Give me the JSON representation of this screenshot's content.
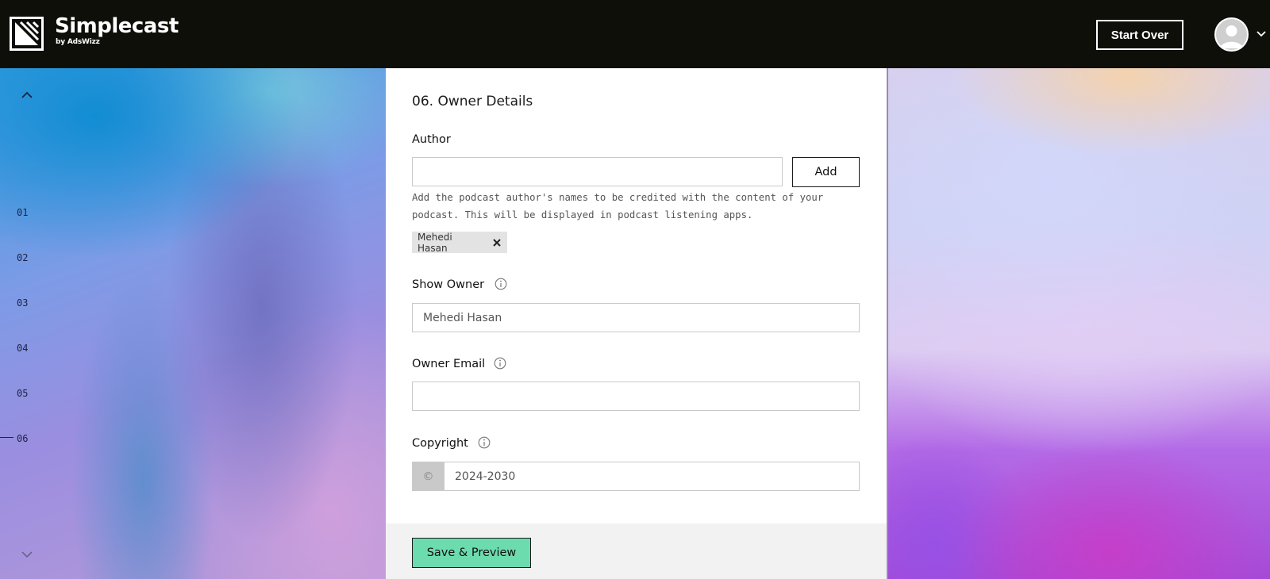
{
  "header": {
    "brand": "Simplecast",
    "brand_sub": "by AdsWizz",
    "start_over_label": "Start Over",
    "logo_icon": "simplecast-logo-icon",
    "avatar_icon": "user-avatar-icon",
    "menu_icon": "chevron-down-icon"
  },
  "steps": {
    "items": [
      "01",
      "02",
      "03",
      "04",
      "05",
      "06"
    ],
    "active": "06",
    "up_icon": "chevron-up-icon",
    "down_icon": "chevron-down-icon"
  },
  "form": {
    "section_title": "06. Owner Details",
    "author": {
      "label": "Author",
      "value": "",
      "add_label": "Add",
      "help": "Add the podcast author's names to be credited with the content of your podcast. This will be displayed in podcast listening apps.",
      "tags": [
        "Mehedi Hasan"
      ]
    },
    "show_owner": {
      "label": "Show Owner",
      "value": "Mehedi Hasan"
    },
    "owner_email": {
      "label": "Owner Email",
      "value": ""
    },
    "copyright": {
      "label": "Copyright",
      "prefix": "©",
      "value": "2024-2030"
    },
    "save_label": "Save & Preview"
  },
  "colors": {
    "header_bg": "#0f0f0a",
    "save_button": "#6cdbae",
    "tag_bg": "#e3e3e3",
    "card_footer": "#f2f2f2"
  }
}
